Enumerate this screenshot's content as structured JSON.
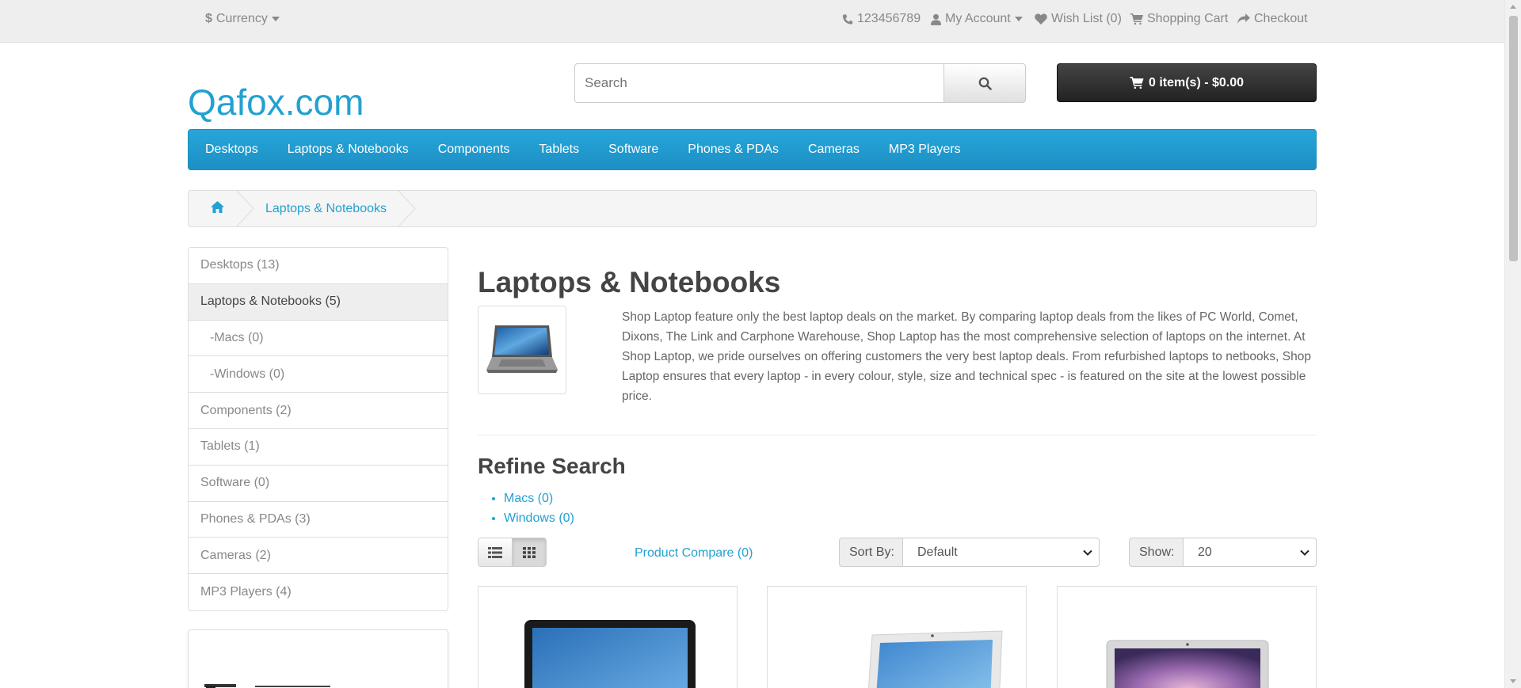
{
  "topbar": {
    "currency": "Currency",
    "currency_symbol": "$",
    "phone": "123456789",
    "my_account": "My Account",
    "wish_list": "Wish List (0)",
    "shopping_cart": "Shopping Cart",
    "checkout": "Checkout"
  },
  "header": {
    "logo": "Qafox.com",
    "search_placeholder": "Search",
    "cart_label": "0 item(s) - $0.00"
  },
  "menu": [
    "Desktops",
    "Laptops & Notebooks",
    "Components",
    "Tablets",
    "Software",
    "Phones & PDAs",
    "Cameras",
    "MP3 Players"
  ],
  "breadcrumb": {
    "current": "Laptops & Notebooks"
  },
  "sidebar": [
    {
      "label": "Desktops (13)",
      "active": false,
      "sub": false
    },
    {
      "label": "Laptops & Notebooks (5)",
      "active": true,
      "sub": false
    },
    {
      "label": "-Macs (0)",
      "active": false,
      "sub": true
    },
    {
      "label": "-Windows (0)",
      "active": false,
      "sub": true
    },
    {
      "label": "Components (2)",
      "active": false,
      "sub": false
    },
    {
      "label": "Tablets (1)",
      "active": false,
      "sub": false
    },
    {
      "label": "Software (0)",
      "active": false,
      "sub": false
    },
    {
      "label": "Phones & PDAs (3)",
      "active": false,
      "sub": false
    },
    {
      "label": "Cameras (2)",
      "active": false,
      "sub": false
    },
    {
      "label": "MP3 Players (4)",
      "active": false,
      "sub": false
    }
  ],
  "content": {
    "title": "Laptops & Notebooks",
    "description": "Shop Laptop feature only the best laptop deals on the market. By comparing laptop deals from the likes of PC World, Comet, Dixons, The Link and Carphone Warehouse, Shop Laptop has the most comprehensive selection of laptops on the internet. At Shop Laptop, we pride ourselves on offering customers the very best laptop deals. From refurbished laptops to netbooks, Shop Laptop ensures that every laptop - in every colour, style, size and technical spec - is featured on the site at the lowest possible price.",
    "refine_title": "Refine Search",
    "refine_links": [
      "Macs (0)",
      "Windows (0)"
    ],
    "product_compare": "Product Compare (0)",
    "sort_label": "Sort By:",
    "sort_value": "Default",
    "show_label": "Show:",
    "show_value": "20"
  },
  "colors": {
    "brand": "#23a1d1",
    "menu_bg": "#229ac8",
    "cart_bg": "#303030"
  }
}
